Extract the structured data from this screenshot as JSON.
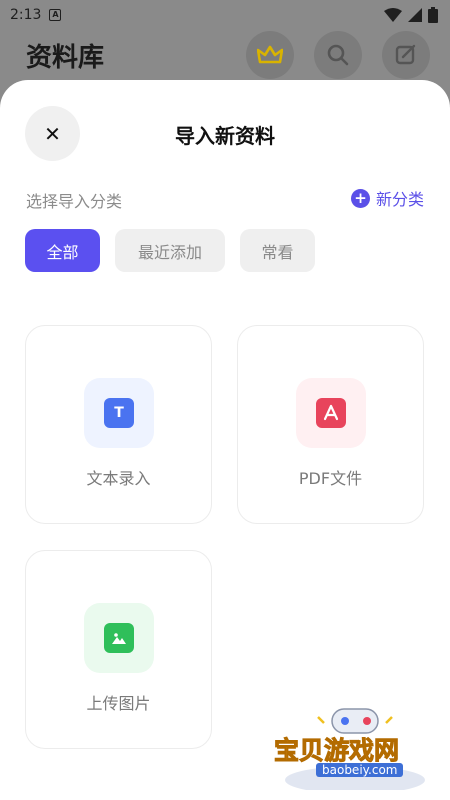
{
  "status_bar": {
    "time": "2:13",
    "app_icon_letter": "A"
  },
  "background_app": {
    "title": "资料库"
  },
  "sheet": {
    "title": "导入新资料",
    "close_symbol": "✕",
    "section_label": "选择导入分类",
    "new_category_label": "新分类",
    "chips": [
      {
        "label": "全部",
        "active": true
      },
      {
        "label": "最近添加",
        "active": false
      },
      {
        "label": "常看",
        "active": false
      }
    ],
    "cards": [
      {
        "label": "文本录入",
        "icon_letter": "T",
        "icon": "text-icon"
      },
      {
        "label": "PDF文件",
        "icon_letter": "",
        "icon": "pdf-icon"
      },
      {
        "label": "上传图片",
        "icon_letter": "",
        "icon": "image-icon"
      }
    ]
  },
  "watermark": {
    "brand": "宝贝游戏网",
    "domain": "baobeiy.com"
  },
  "colors": {
    "accent": "#5b50f0",
    "text_icon": "#4a73f0",
    "pdf_icon": "#e8445c",
    "image_icon": "#2fbf5a",
    "crown": "#d9b300"
  }
}
